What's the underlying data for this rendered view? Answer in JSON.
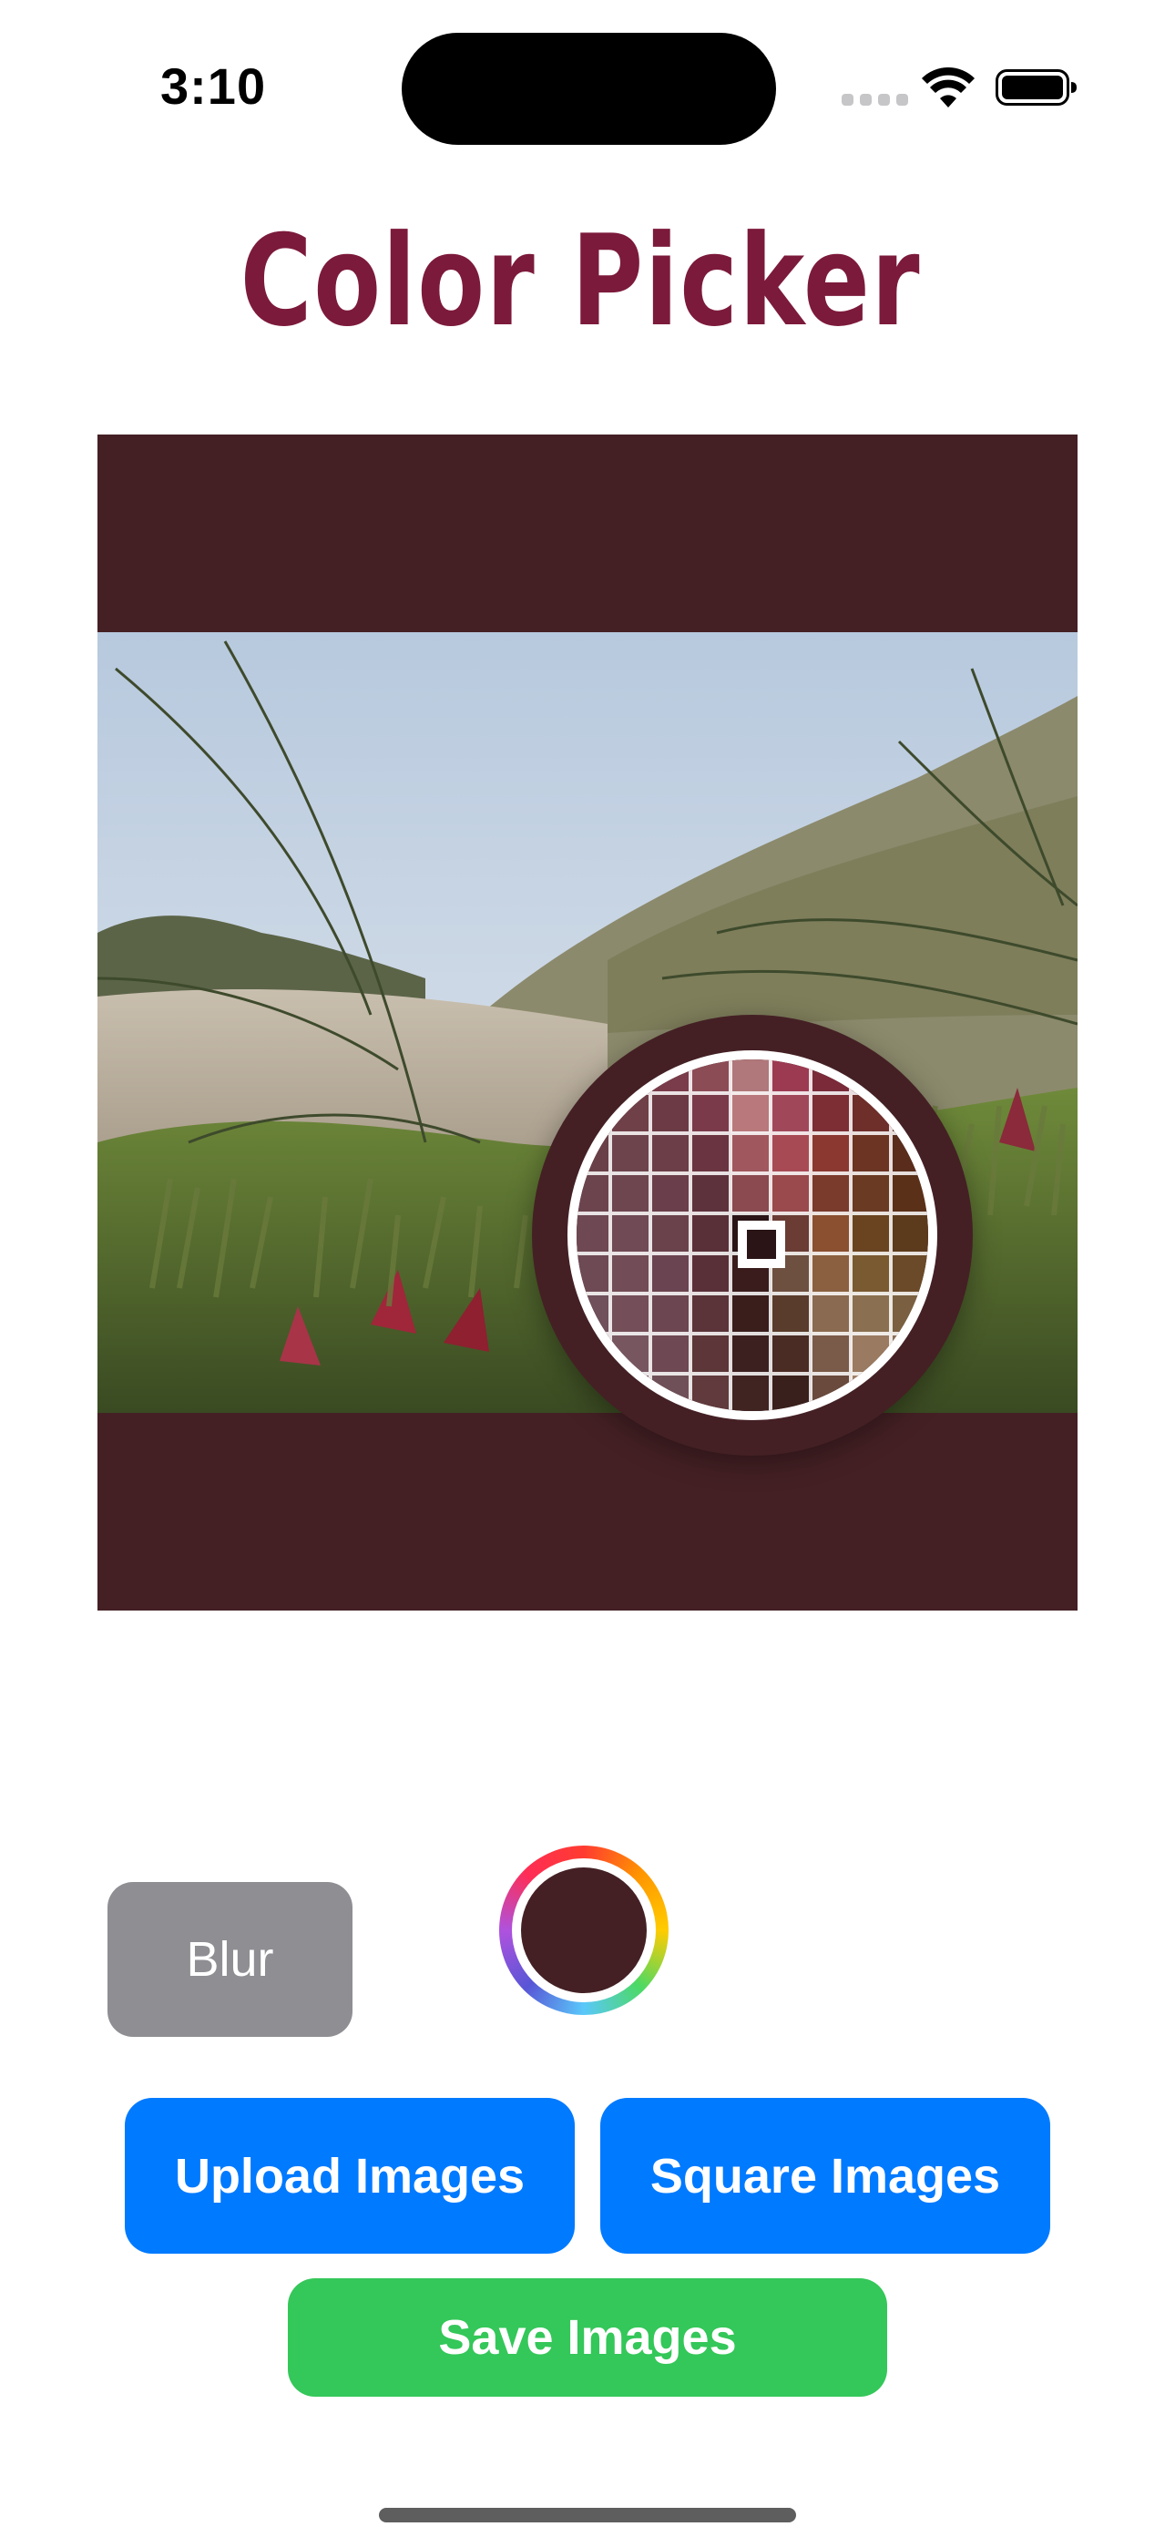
{
  "status_bar": {
    "time": "3:10"
  },
  "header": {
    "title": "Color Picker",
    "title_color": "#7c1a3b"
  },
  "canvas": {
    "background_color": "#442024",
    "image_description_icon": "photo-beach-grass"
  },
  "loupe": {
    "selected_color": "#2a1416",
    "pixels": [
      [
        "#6b3a40",
        "#6e3b43",
        "#7a3c4a",
        "#8c4c56",
        "#b0787a",
        "#9c3a52",
        "#7a2a38",
        "#6a2a2e",
        "#5a2a26"
      ],
      [
        "#6a3a42",
        "#704048",
        "#6c3a44",
        "#7a3a4a",
        "#b8787c",
        "#a0485a",
        "#7c2e34",
        "#6e2e2a",
        "#5c2c24"
      ],
      [
        "#6a4048",
        "#6e444c",
        "#6c3e48",
        "#6a3440",
        "#a0585e",
        "#a84a54",
        "#8a3830",
        "#6c3422",
        "#5a2c1c"
      ],
      [
        "#6c444e",
        "#6e4650",
        "#6a3e4a",
        "#5e323c",
        "#8a4a50",
        "#9a4a4c",
        "#7a3a2c",
        "#6a3a22",
        "#5a3018"
      ],
      [
        "#6e4852",
        "#704a54",
        "#6a424c",
        "#5a3038",
        "#2a1416",
        "#6a3c34",
        "#8a5030",
        "#6a4420",
        "#5c3a1c"
      ],
      [
        "#6e4a54",
        "#724c56",
        "#6a4450",
        "#5a3038",
        "#3a1c1c",
        "#6e5040",
        "#8a6040",
        "#7a5a30",
        "#6a4a28"
      ],
      [
        "#70505a",
        "#744e58",
        "#6c4650",
        "#5a3438",
        "#3a1e1c",
        "#5a3c2c",
        "#8a6a50",
        "#8a7050",
        "#7a6040"
      ],
      [
        "#72545c",
        "#785660",
        "#6e4852",
        "#5c3638",
        "#3c2020",
        "#4a2c24",
        "#7a5a48",
        "#9a7a60",
        "#8a7058"
      ],
      [
        "#745660",
        "#7a5a62",
        "#705058",
        "#603a3c",
        "#402422",
        "#3a201c",
        "#6a4a3c",
        "#a08068",
        "#b09080"
      ]
    ]
  },
  "controls": {
    "blur_label": "Blur",
    "color_well_color": "#442024",
    "upload_label": "Upload Images",
    "square_label": "Square Images",
    "save_label": "Save Images"
  },
  "colors": {
    "primary_button": "#007aff",
    "save_button": "#34c759",
    "blur_button": "#8e8e93"
  }
}
